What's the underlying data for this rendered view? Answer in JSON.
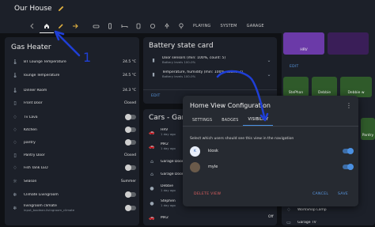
{
  "header": {
    "title": "Our House",
    "tabs": [
      {
        "icon": "back-arrow-icon"
      },
      {
        "icon": "home-icon"
      },
      {
        "icon": "pencil-icon"
      },
      {
        "icon": "forward-arrow-icon"
      },
      {
        "icon": "sofa-icon"
      },
      {
        "icon": "phone-icon"
      },
      {
        "icon": "bed-icon"
      },
      {
        "icon": "toilet-icon"
      },
      {
        "icon": "kitchen-icon"
      },
      {
        "icon": "lamp-icon"
      },
      {
        "icon": "tree-icon"
      }
    ],
    "text_tabs": [
      "PLAYING",
      "SYSTEM",
      "GARAGE"
    ]
  },
  "gas_card": {
    "title": "Gas Heater",
    "rows": [
      {
        "label": "BT Lounge Temperature",
        "value": "24.5 °C",
        "icon": "thermometer-icon"
      },
      {
        "label": "lounge Temperature",
        "value": "24.5 °C",
        "icon": "thermometer-icon"
      },
      {
        "label": "Dinner Room",
        "value": "24.3 °C",
        "icon": "thermometer-icon"
      },
      {
        "label": "Front Door",
        "value": "Closed",
        "icon": "door-icon"
      },
      {
        "label": "Tv Lava",
        "value": "",
        "icon": "lamp-icon",
        "toggle": "off"
      },
      {
        "label": "Kitchen",
        "value": "",
        "icon": "lamp-icon",
        "toggle": "off"
      },
      {
        "label": "pantry",
        "value": "",
        "icon": "lamp-icon",
        "toggle": "off"
      },
      {
        "label": "Pantry Door",
        "value": "Closed",
        "icon": "door-icon"
      },
      {
        "label": "Fish Tank LED",
        "value": "",
        "icon": "lamp-icon",
        "toggle": "off"
      },
      {
        "label": "Season",
        "value": "Summer",
        "icon": "season-icon"
      },
      {
        "label": "Climate Livingroom",
        "value": "",
        "icon": "climate-icon",
        "toggle": "off"
      },
      {
        "label": "livingroom climate",
        "sub": "input_boolean.livingroom_climate",
        "value": "",
        "icon": "climate-icon",
        "toggle": "off"
      }
    ]
  },
  "battery_card": {
    "title": "Battery state card",
    "rows": [
      {
        "label": "Door sensors (min: 100%, count: 5)",
        "sub": "Battery levels 100-0%"
      },
      {
        "label": "Temperature, humidity (min: 100%, count: 7)",
        "sub": "Battery levels 100-0%"
      }
    ],
    "edit": "EDIT"
  },
  "cars_card": {
    "title": "Cars - Gara",
    "rows": [
      {
        "label": "HRV",
        "sub": "1 day ago",
        "icon": "car-icon"
      },
      {
        "label": "MR2",
        "sub": "1 day ago",
        "icon": "car-icon"
      },
      {
        "label": "Garage Door",
        "icon": "garage-icon"
      },
      {
        "label": "Garage Door2",
        "icon": "garage-icon"
      },
      {
        "label": "Debbie",
        "sub": "1 day ago",
        "icon": "person-icon"
      },
      {
        "label": "Stephen",
        "sub": "1 day ago",
        "icon": "person-icon"
      },
      {
        "label": "MR2",
        "icon": "car-icon"
      }
    ],
    "peek_value": "Off"
  },
  "tiles_card": {
    "tiles": [
      {
        "label": "HRV",
        "color": "#6b3aa8"
      },
      {
        "label": "StePhan",
        "color": "#2f5a2a"
      },
      {
        "label": "Debbie",
        "color": "#2f5a2a"
      },
      {
        "label": "Debbie w",
        "color": "#2f5a2a"
      },
      {
        "label": "Pantry",
        "color": "#2f5a2a"
      }
    ],
    "edit": "EDIT",
    "bottom_rows": [
      "WorkShop Lamp",
      "Garage TV"
    ]
  },
  "dialog": {
    "title": "Home View Configuration",
    "tabs": [
      "SETTINGS",
      "BADGES",
      "VISIBILITY"
    ],
    "active_tab": "VISIBILITY",
    "info": "Select which users should see this view in the navigation",
    "users": [
      {
        "name": "kiosk",
        "avatar": "K",
        "enabled": true
      },
      {
        "name": "myle",
        "avatar": "",
        "enabled": true
      }
    ],
    "delete": "DELETE VIEW",
    "cancel": "CANCEL",
    "save": "SAVE"
  },
  "annotations": {
    "label": "1",
    "color": "#1f3fd6"
  }
}
